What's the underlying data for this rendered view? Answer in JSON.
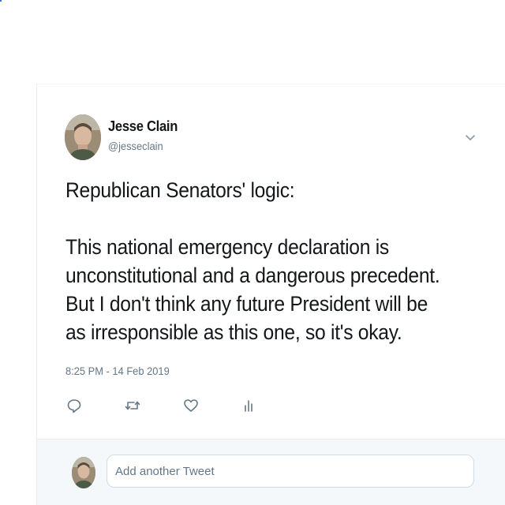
{
  "tweet": {
    "author": {
      "name": "Jesse Clain",
      "handle": "@jesseclain"
    },
    "text": {
      "line1": "Republican Senators' logic:",
      "line2": "This national emergency declaration is",
      "line3": "unconstitutional and a dangerous precedent.",
      "line4": "But I don't think any future President will be",
      "line5": "as irresponsible as this one, so it's okay."
    },
    "timestamp": "8:25 PM - 14 Feb 2019",
    "actions": [
      {
        "icon": "reply-icon"
      },
      {
        "icon": "retweet-icon"
      },
      {
        "icon": "like-icon"
      },
      {
        "icon": "analytics-icon"
      }
    ],
    "menu_icon": "chevron-down-icon"
  },
  "reply": {
    "placeholder": "Add another Tweet"
  },
  "colors": {
    "text_primary": "#14171a",
    "text_secondary": "#657786",
    "reply_background": "#f5f8fa",
    "border": "#e6ecf0"
  }
}
